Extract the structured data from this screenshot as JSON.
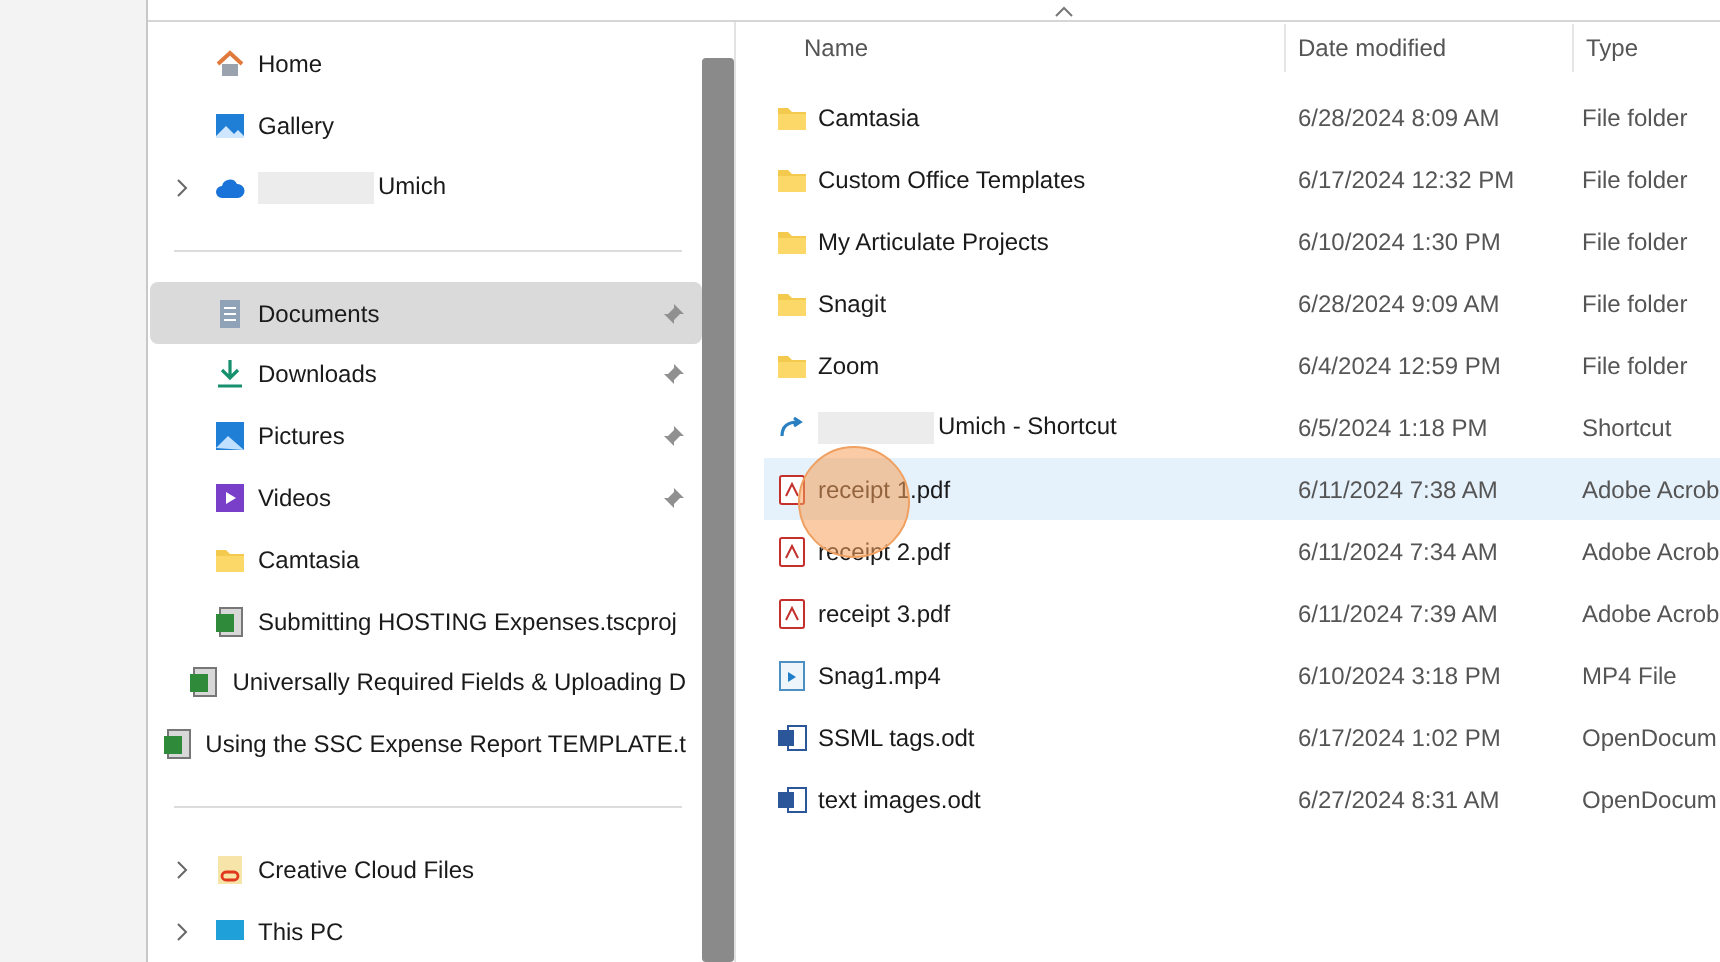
{
  "sidebar": {
    "groups": [
      {
        "items": [
          {
            "kind": "home",
            "label": "Home",
            "expandable": false,
            "pinned": false,
            "selected": false,
            "redacted": false
          },
          {
            "kind": "gallery",
            "label": "Gallery",
            "expandable": false,
            "pinned": false,
            "selected": false,
            "redacted": false
          },
          {
            "kind": "cloud",
            "label": "Umich",
            "expandable": true,
            "pinned": false,
            "selected": false,
            "redacted": true
          }
        ]
      },
      {
        "items": [
          {
            "kind": "documents",
            "label": "Documents",
            "expandable": false,
            "pinned": true,
            "selected": true,
            "redacted": false
          },
          {
            "kind": "download",
            "label": "Downloads",
            "expandable": false,
            "pinned": true,
            "selected": false,
            "redacted": false
          },
          {
            "kind": "pictures",
            "label": "Pictures",
            "expandable": false,
            "pinned": true,
            "selected": false,
            "redacted": false
          },
          {
            "kind": "videos",
            "label": "Videos",
            "expandable": false,
            "pinned": true,
            "selected": false,
            "redacted": false
          },
          {
            "kind": "folder",
            "label": "Camtasia",
            "expandable": false,
            "pinned": false,
            "selected": false,
            "redacted": false
          },
          {
            "kind": "project",
            "label": "Submitting HOSTING Expenses.tscproj",
            "expandable": false,
            "pinned": false,
            "selected": false,
            "redacted": false
          },
          {
            "kind": "project",
            "label": "Universally Required Fields & Uploading D",
            "expandable": false,
            "pinned": false,
            "selected": false,
            "redacted": false
          },
          {
            "kind": "project",
            "label": "Using the SSC Expense Report TEMPLATE.t",
            "expandable": false,
            "pinned": false,
            "selected": false,
            "redacted": false
          }
        ]
      },
      {
        "items": [
          {
            "kind": "creative",
            "label": "Creative Cloud Files",
            "expandable": true,
            "pinned": false,
            "selected": false,
            "redacted": false
          },
          {
            "kind": "pc",
            "label": "This PC",
            "expandable": true,
            "pinned": false,
            "selected": false,
            "redacted": false
          }
        ]
      }
    ]
  },
  "file_list": {
    "columns": [
      "Name",
      "Date modified",
      "Type"
    ],
    "rows": [
      {
        "kind": "folder",
        "name": "Camtasia",
        "date": "6/28/2024 8:09 AM",
        "type": "File folder",
        "selected": false,
        "redacted": false
      },
      {
        "kind": "folder",
        "name": "Custom Office Templates",
        "date": "6/17/2024 12:32 PM",
        "type": "File folder",
        "selected": false,
        "redacted": false
      },
      {
        "kind": "folder",
        "name": "My Articulate Projects",
        "date": "6/10/2024 1:30 PM",
        "type": "File folder",
        "selected": false,
        "redacted": false
      },
      {
        "kind": "folder",
        "name": "Snagit",
        "date": "6/28/2024 9:09 AM",
        "type": "File folder",
        "selected": false,
        "redacted": false
      },
      {
        "kind": "folder",
        "name": "Zoom",
        "date": "6/4/2024 12:59 PM",
        "type": "File folder",
        "selected": false,
        "redacted": false
      },
      {
        "kind": "shortcut",
        "name": "Umich - Shortcut",
        "date": "6/5/2024 1:18 PM",
        "type": "Shortcut",
        "selected": false,
        "redacted": true
      },
      {
        "kind": "pdf",
        "name": "receipt 1.pdf",
        "date": "6/11/2024 7:38 AM",
        "type": "Adobe Acrob",
        "selected": true,
        "redacted": false
      },
      {
        "kind": "pdf",
        "name": "receipt 2.pdf",
        "date": "6/11/2024 7:34 AM",
        "type": "Adobe Acrob",
        "selected": false,
        "redacted": false
      },
      {
        "kind": "pdf",
        "name": "receipt 3.pdf",
        "date": "6/11/2024 7:39 AM",
        "type": "Adobe Acrob",
        "selected": false,
        "redacted": false
      },
      {
        "kind": "video",
        "name": "Snag1.mp4",
        "date": "6/10/2024 3:18 PM",
        "type": "MP4 File",
        "selected": false,
        "redacted": false
      },
      {
        "kind": "word",
        "name": "SSML tags.odt",
        "date": "6/17/2024 1:02 PM",
        "type": "OpenDocum",
        "selected": false,
        "redacted": false
      },
      {
        "kind": "word",
        "name": "text images.odt",
        "date": "6/27/2024 8:31 AM",
        "type": "OpenDocum",
        "selected": false,
        "redacted": false
      }
    ]
  }
}
